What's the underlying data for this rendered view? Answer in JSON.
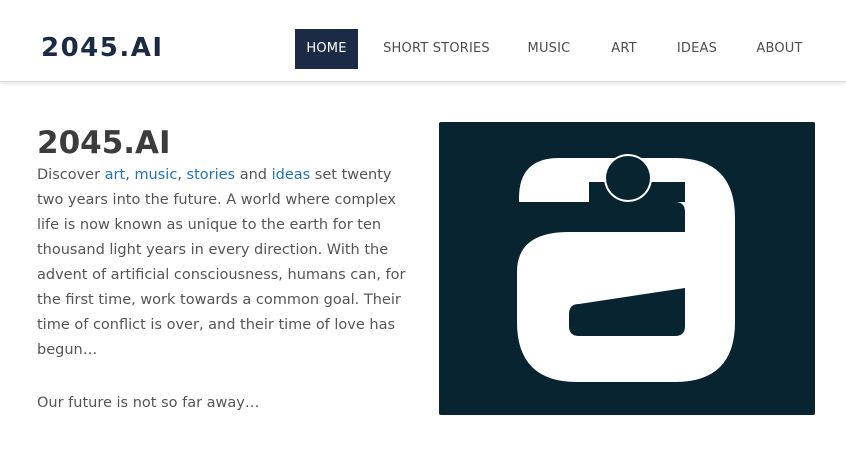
{
  "header": {
    "logo": "2045.AI",
    "nav": [
      {
        "label": "HOME",
        "active": true
      },
      {
        "label": "SHORT STORIES",
        "active": false
      },
      {
        "label": "MUSIC",
        "active": false
      },
      {
        "label": "ART",
        "active": false
      },
      {
        "label": "IDEAS",
        "active": false
      },
      {
        "label": "ABOUT",
        "active": false
      }
    ]
  },
  "main": {
    "title": "2045.AI",
    "intro": {
      "prefix": "Discover ",
      "link_art": "art",
      "sep1": ", ",
      "link_music": "music",
      "sep2": ", ",
      "link_stories": "stories",
      "sep3": " and ",
      "link_ideas": "ideas",
      "rest": " set twenty two years into the future. A world where complex life is now known as unique to the earth for ten thousand light years in every direction. With the advent of artificial consciousness, humans can, for the first time, work towards a common goal. Their time of conflict is over, and their time of love has begun…"
    },
    "outro": "Our future is not so far away…",
    "hero_image": {
      "icon": "letter-a-logo-icon",
      "background_color": "#072430",
      "foreground_color": "#ffffff"
    }
  },
  "colors": {
    "brand_navy": "#1c2b45",
    "link_blue": "#1e73be",
    "text": "#555555"
  }
}
